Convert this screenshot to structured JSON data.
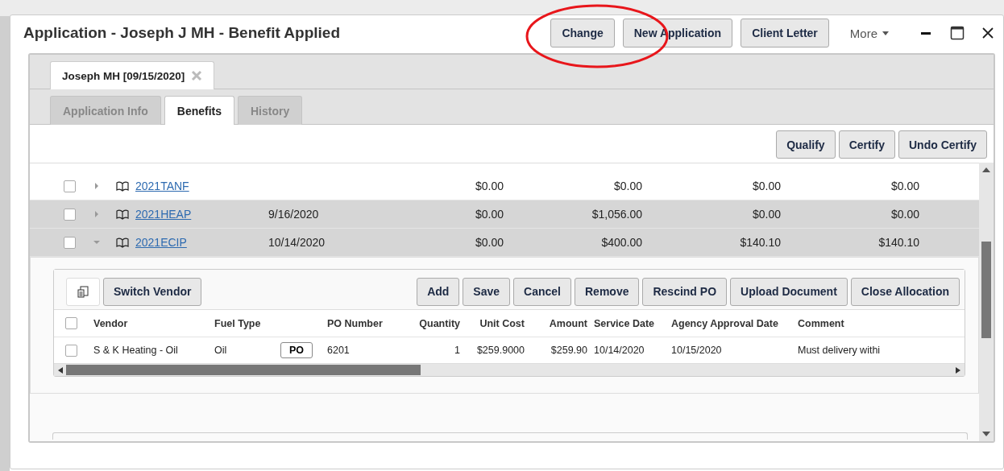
{
  "window": {
    "title": "Application - Joseph J MH - Benefit Applied",
    "buttons": [
      "Change",
      "New Application",
      "Client Letter"
    ],
    "more_menu": "More"
  },
  "record_tabs": [
    {
      "label": "Joseph MH [09/15/2020]",
      "selected": true
    }
  ],
  "tabs": [
    {
      "label": "Application Info",
      "selected": false
    },
    {
      "label": "Benefits",
      "selected": true
    },
    {
      "label": "History",
      "selected": false
    }
  ],
  "actions": [
    "Qualify",
    "Certify",
    "Undo Certify"
  ],
  "benefits": [
    {
      "checked": false,
      "expanded": false,
      "selected": false,
      "name": "2021TANF",
      "amounts": [
        "$0.00",
        "$0.00",
        "$0.00",
        "$0.00"
      ]
    },
    {
      "checked": false,
      "expanded": false,
      "selected": true,
      "name": "2021HEAP",
      "date": "9/16/2020",
      "amounts": [
        "$0.00",
        "$1,056.00",
        "$0.00",
        "$0.00"
      ]
    },
    {
      "checked": false,
      "expanded": true,
      "selected": true,
      "name": "2021ECIP",
      "date": "10/14/2020",
      "amounts": [
        "$0.00",
        "$400.00",
        "$140.10",
        "$140.10"
      ]
    }
  ],
  "allocation": {
    "left_button": "Switch Vendor",
    "buttons": [
      "Add",
      "Save",
      "Cancel",
      "Remove",
      "Rescind PO",
      "Upload Document",
      "Close Allocation"
    ],
    "header_checked": false,
    "columns": [
      "Vendor",
      "Fuel Type",
      "",
      "PO Number",
      "Quantity",
      "Unit Cost",
      "Amount",
      "Service Date",
      "Agency Approval Date",
      "Comment"
    ],
    "rows": [
      {
        "checked": false,
        "vendor": "S & K Heating - Oil",
        "fuel_type": "Oil",
        "po_button": "PO",
        "po_number": "6201",
        "quantity": "1",
        "unit_cost": "$259.9000",
        "amount": "$259.90",
        "service_date": "10/14/2020",
        "agency_approval_date": "10/15/2020",
        "comment": "Must delivery withi"
      }
    ]
  }
}
